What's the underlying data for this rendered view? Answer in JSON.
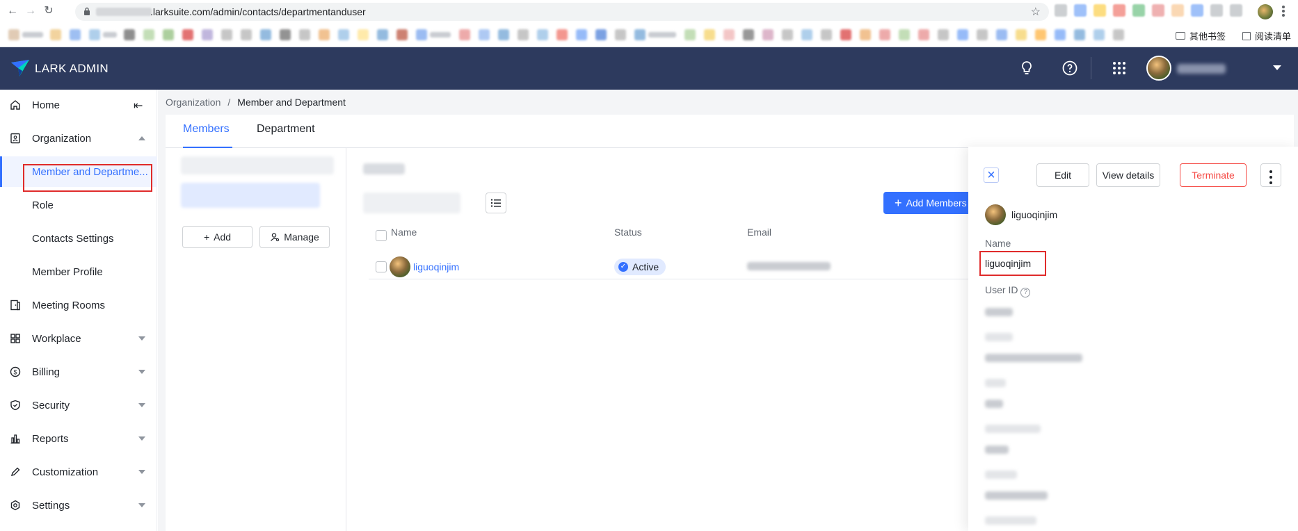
{
  "browser": {
    "url_visible": ".larksuite.com/admin/contacts/departmentanduser",
    "bookmarks_other": "其他书签",
    "reading_list": "阅读清单"
  },
  "header": {
    "brand": "LARK ADMIN",
    "icons": [
      "lightbulb-icon",
      "help-icon",
      "apps-grid-icon"
    ]
  },
  "sidebar": {
    "items": [
      {
        "label": "Home",
        "icon": "home-icon"
      },
      {
        "label": "Organization",
        "icon": "organization-icon",
        "expanded": true
      },
      {
        "label": "Member and Departme...",
        "active": true
      },
      {
        "label": "Role"
      },
      {
        "label": "Contacts Settings"
      },
      {
        "label": "Member Profile"
      },
      {
        "label": "Meeting Rooms",
        "icon": "meeting-room-icon"
      },
      {
        "label": "Workplace",
        "icon": "workplace-icon"
      },
      {
        "label": "Billing",
        "icon": "billing-icon"
      },
      {
        "label": "Security",
        "icon": "shield-icon"
      },
      {
        "label": "Reports",
        "icon": "chart-icon"
      },
      {
        "label": "Customization",
        "icon": "pen-icon"
      },
      {
        "label": "Settings",
        "icon": "settings-icon"
      }
    ]
  },
  "breadcrumb": {
    "parent": "Organization",
    "separator": "/",
    "current": "Member and Department"
  },
  "tabs": [
    {
      "label": "Members",
      "active": true
    },
    {
      "label": "Department"
    }
  ],
  "left_panel": {
    "add_label": "Add",
    "manage_label": "Manage"
  },
  "toolbar": {
    "add_members_label": "Add Members"
  },
  "table": {
    "columns": [
      "Name",
      "Status",
      "Email"
    ],
    "rows": [
      {
        "name": "liguoqinjim",
        "status": "Active"
      }
    ]
  },
  "drawer": {
    "edit_label": "Edit",
    "view_details_label": "View details",
    "terminate_label": "Terminate",
    "user_name": "liguoqinjim",
    "name_label": "Name",
    "name_value": "liguoqinjim",
    "user_id_label": "User ID"
  },
  "colors": {
    "header_bg": "#2d3a5e",
    "accent": "#3370ff",
    "danger": "#f54a45",
    "highlight_box": "#e02b2b"
  }
}
